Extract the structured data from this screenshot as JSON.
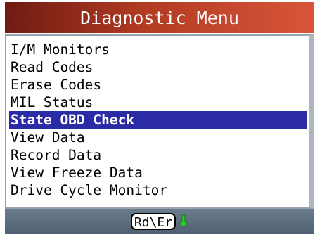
{
  "header": {
    "title": "Diagnostic Menu"
  },
  "menu": {
    "items": [
      {
        "label": "I/M Monitors",
        "selected": false
      },
      {
        "label": "Read Codes",
        "selected": false
      },
      {
        "label": "Erase Codes",
        "selected": false
      },
      {
        "label": "MIL Status",
        "selected": false
      },
      {
        "label": "State OBD Check",
        "selected": true
      },
      {
        "label": "View Data",
        "selected": false
      },
      {
        "label": "Record Data",
        "selected": false
      },
      {
        "label": "View Freeze Data",
        "selected": false
      },
      {
        "label": "Drive Cycle Monitor",
        "selected": false
      }
    ]
  },
  "footer": {
    "key_label": "Rd\\Er",
    "arrow_icon": "down-arrow-icon"
  },
  "colors": {
    "header": "#b23b22",
    "selection": "#2b2ba6",
    "arrow": "#2bd12b",
    "footer": "#5a6b7c"
  }
}
